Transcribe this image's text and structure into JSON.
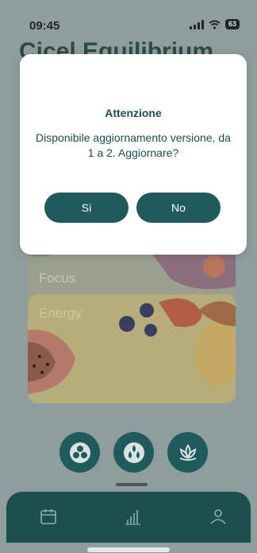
{
  "status_bar": {
    "time": "09:45",
    "battery": "63"
  },
  "app": {
    "title": "Cicel Equilibrium"
  },
  "cards": [
    {
      "label": "Focus"
    },
    {
      "label": "Energy"
    }
  ],
  "dialog": {
    "title": "Attenzione",
    "message": "Disponibile aggiornamento versione, da 1 a 2. Aggiornare?",
    "yes_label": "Si",
    "no_label": "No"
  },
  "round_buttons": [
    {
      "icon": "circles-icon"
    },
    {
      "icon": "drops-icon"
    },
    {
      "icon": "lotus-icon"
    }
  ],
  "tabbar": [
    {
      "icon": "calendar-icon"
    },
    {
      "icon": "chart-icon"
    },
    {
      "icon": "profile-icon"
    }
  ]
}
